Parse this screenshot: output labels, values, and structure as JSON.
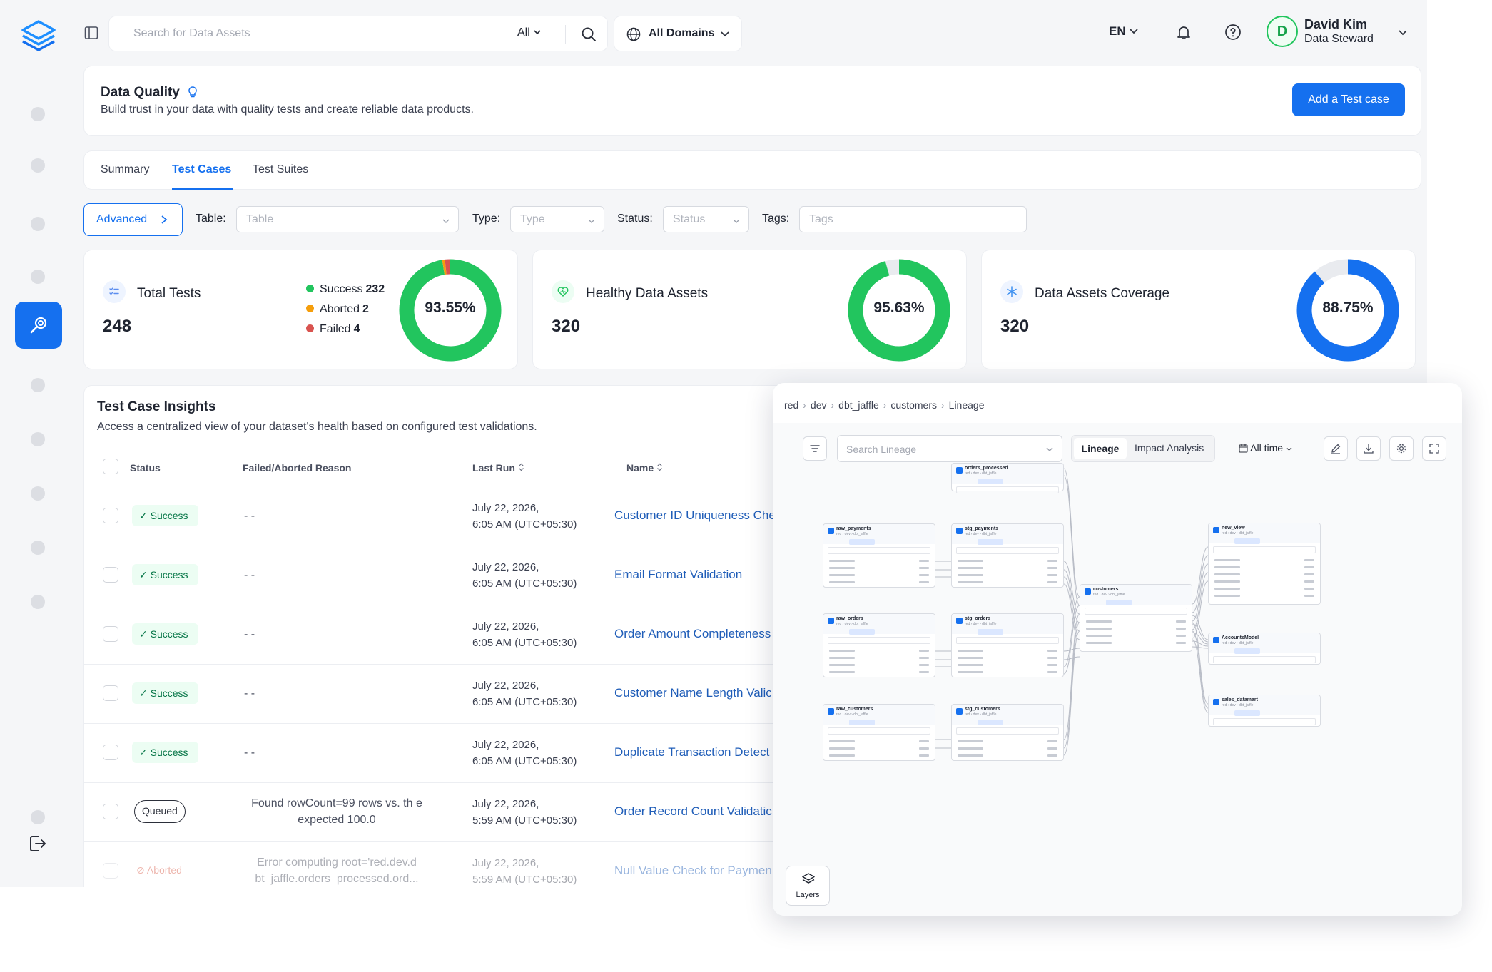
{
  "topbar": {
    "search_placeholder": "Search for Data Assets",
    "search_scope": "All",
    "domains_label": "All Domains",
    "language": "EN",
    "user": {
      "initial": "D",
      "name": "David Kim",
      "role": "Data Steward"
    }
  },
  "header": {
    "title": "Data Quality",
    "subtitle": "Build trust in your data with quality tests and create reliable data products.",
    "add_button": "Add a Test case"
  },
  "tabs": [
    {
      "label": "Summary",
      "active": false
    },
    {
      "label": "Test Cases",
      "active": true
    },
    {
      "label": "Test Suites",
      "active": false
    }
  ],
  "filters": {
    "advanced": "Advanced",
    "table_label": "Table",
    "table_placeholder": "Table",
    "type_label": "Type",
    "type_placeholder": "Type",
    "status_label": "Status",
    "status_placeholder": "Status",
    "tags_label": "Tags",
    "tags_placeholder": "Tags"
  },
  "stats": [
    {
      "title": "Total Tests",
      "value": "248",
      "percent_label": "93.55%",
      "percent": 93.55,
      "color": "#22c55e",
      "legend": [
        {
          "label": "Success",
          "count": "232",
          "color": "#22c55e"
        },
        {
          "label": "Aborted",
          "count": "2",
          "color": "#f59e0b"
        },
        {
          "label": "Failed",
          "count": "4",
          "color": "#d9534f"
        }
      ]
    },
    {
      "title": "Healthy Data Assets",
      "value": "320",
      "percent_label": "95.63%",
      "percent": 95.63,
      "color": "#22c55e"
    },
    {
      "title": "Data Assets Coverage",
      "value": "320",
      "percent_label": "88.75%",
      "percent": 88.75,
      "color": "#1570ef"
    }
  ],
  "insights": {
    "title": "Test Case Insights",
    "subtitle": "Access a centralized view of your dataset's health based on configured test validations.",
    "columns": [
      "Status",
      "Failed/Aborted Reason",
      "Last Run",
      "Name"
    ],
    "rows": [
      {
        "status": "Success",
        "reason": "- -",
        "run_date": "July 22, 2026,",
        "run_time": "6:05 AM (UTC+05:30)",
        "name": "Customer ID Uniqueness Che"
      },
      {
        "status": "Success",
        "reason": "- -",
        "run_date": "July 22, 2026,",
        "run_time": "6:05 AM (UTC+05:30)",
        "name": "Email Format Validation"
      },
      {
        "status": "Success",
        "reason": "- -",
        "run_date": "July 22, 2026,",
        "run_time": "6:05 AM (UTC+05:30)",
        "name": "Order Amount Completeness"
      },
      {
        "status": "Success",
        "reason": "- -",
        "run_date": "July 22, 2026,",
        "run_time": "6:05 AM (UTC+05:30)",
        "name": "Customer Name Length Valic"
      },
      {
        "status": "Success",
        "reason": "- -",
        "run_date": "July 22, 2026,",
        "run_time": "6:05 AM (UTC+05:30)",
        "name": "Duplicate Transaction Detect"
      },
      {
        "status": "Queued",
        "reason": "Found rowCount=99 rows vs. th e expected 100.0",
        "run_date": "July 22, 2026,",
        "run_time": "5:59 AM (UTC+05:30)",
        "name": "Order Record Count Validatic"
      },
      {
        "status": "Aborted",
        "reason": "Error computing root='red.dev.d bt_jaffle.orders_processed.ord...",
        "run_date": "July 22, 2026,",
        "run_time": "5:59 AM (UTC+05:30)",
        "name": "Null Value Check for Paymen"
      }
    ]
  },
  "lineage": {
    "breadcrumb": [
      "red",
      "dev",
      "dbt_jaffle",
      "customers",
      "Lineage"
    ],
    "search_placeholder": "Search Lineage",
    "tab_lineage": "Lineage",
    "tab_impact": "Impact Analysis",
    "time_filter": "All time",
    "layers_label": "Layers",
    "nodes": [
      {
        "name": "orders_processed"
      },
      {
        "name": "raw_payments"
      },
      {
        "name": "stg_payments"
      },
      {
        "name": "raw_orders"
      },
      {
        "name": "stg_orders"
      },
      {
        "name": "raw_customers"
      },
      {
        "name": "stg_customers"
      },
      {
        "name": "customers"
      },
      {
        "name": "new_view"
      },
      {
        "name": "AccountsModel"
      },
      {
        "name": "sales_datamart"
      }
    ]
  }
}
